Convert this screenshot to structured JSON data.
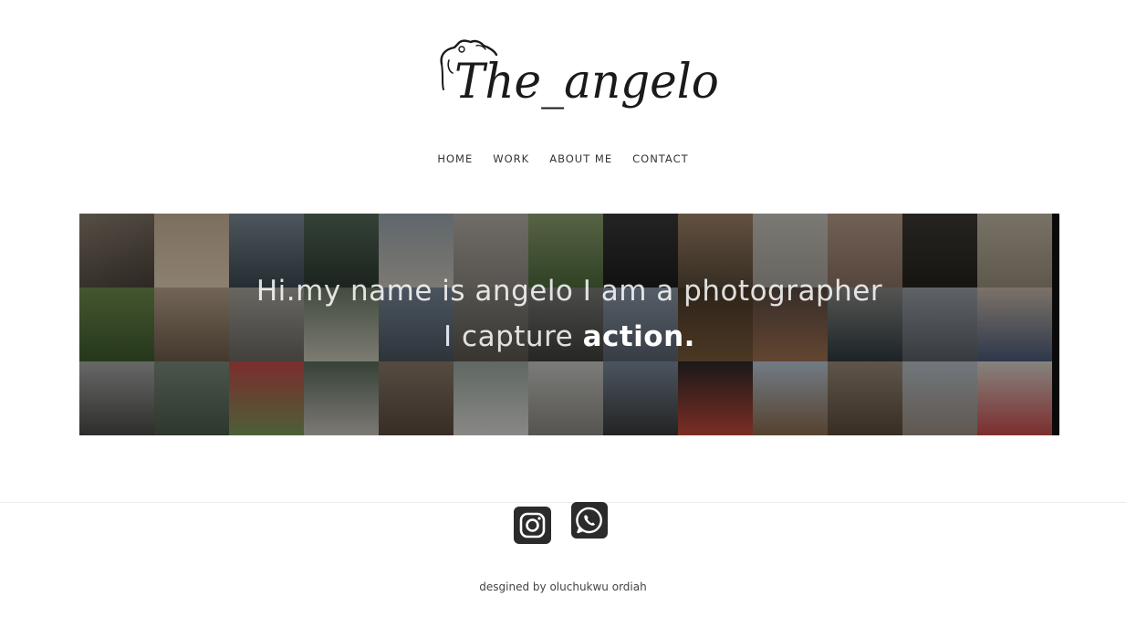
{
  "logo": {
    "text": "The_angelo"
  },
  "nav": [
    {
      "label": "HOME"
    },
    {
      "label": "WORK"
    },
    {
      "label": "ABOUT ME"
    },
    {
      "label": "CONTACT"
    }
  ],
  "hero": {
    "line1": "Hi.my name is angelo I am a photographer",
    "line2_prefix": "I capture ",
    "line2_bold": "action."
  },
  "social": [
    {
      "name": "instagram",
      "icon": "instagram-icon"
    },
    {
      "name": "whatsapp",
      "icon": "whatsapp-icon"
    }
  ],
  "footer": {
    "credit": "desgined by oluchukwu ordiah"
  },
  "colors": {
    "text": "#333333",
    "icon_bg": "#2b2b2b",
    "hero_overlay": "rgba(0,0,0,0.38)"
  }
}
